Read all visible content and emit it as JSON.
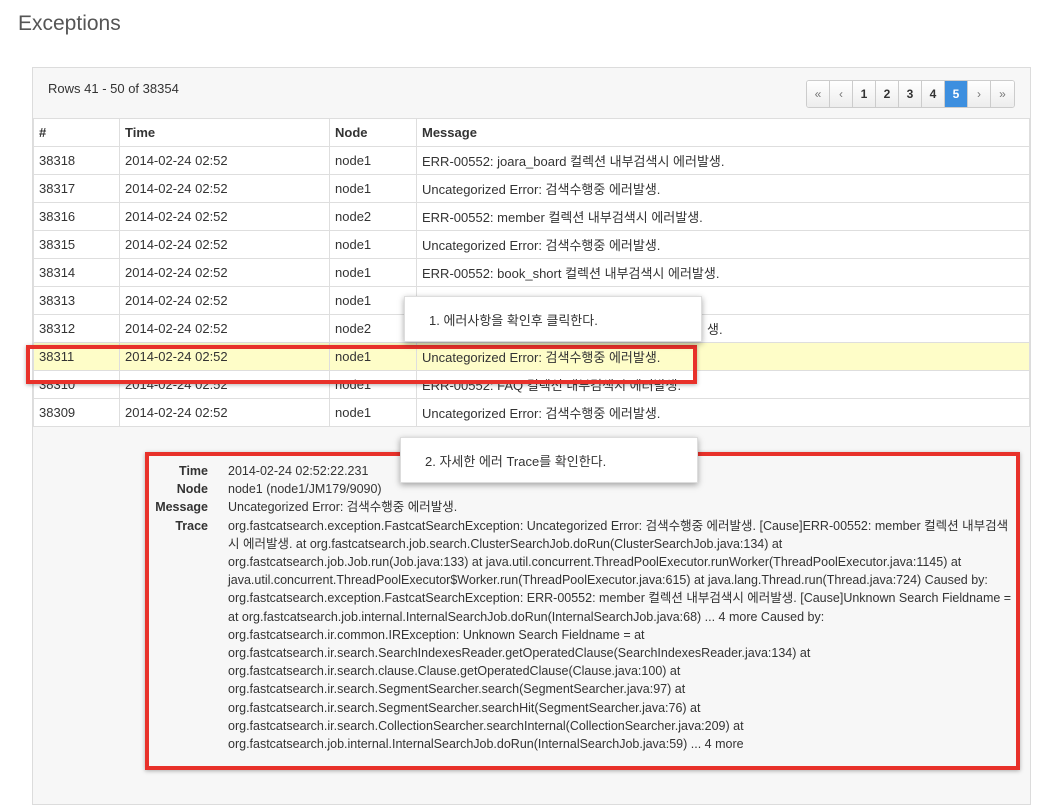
{
  "page": {
    "title": "Exceptions"
  },
  "summary": {
    "rows_text": "Rows 41 - 50 of 38354"
  },
  "pagination": {
    "first": "«",
    "prev": "‹",
    "next": "›",
    "last": "»",
    "pages": [
      "1",
      "2",
      "3",
      "4",
      "5"
    ],
    "active": "5"
  },
  "table": {
    "headers": [
      "#",
      "Time",
      "Node",
      "Message"
    ],
    "rows": [
      {
        "id": "38318",
        "time": "2014-02-24 02:52",
        "node": "node1",
        "message": "ERR-00552: joara_board 컬렉션 내부검색시 에러발생."
      },
      {
        "id": "38317",
        "time": "2014-02-24 02:52",
        "node": "node1",
        "message": "Uncategorized Error: 검색수행중 에러발생."
      },
      {
        "id": "38316",
        "time": "2014-02-24 02:52",
        "node": "node2",
        "message": "ERR-00552: member 컬렉션 내부검색시 에러발생."
      },
      {
        "id": "38315",
        "time": "2014-02-24 02:52",
        "node": "node1",
        "message": "Uncategorized Error: 검색수행중 에러발생."
      },
      {
        "id": "38314",
        "time": "2014-02-24 02:52",
        "node": "node1",
        "message": "ERR-00552: book_short 컬렉션 내부검색시 에러발생."
      },
      {
        "id": "38313",
        "time": "2014-02-24 02:52",
        "node": "node1",
        "message": ""
      },
      {
        "id": "38312",
        "time": "2014-02-24 02:52",
        "node": "node2",
        "message": "생."
      },
      {
        "id": "38311",
        "time": "2014-02-24 02:52",
        "node": "node1",
        "message": "Uncategorized Error: 검색수행중 에러발생."
      },
      {
        "id": "38310",
        "time": "2014-02-24 02:52",
        "node": "node1",
        "message": "ERR-00552: FAQ 컬렉션 내부검색시 에러발생."
      },
      {
        "id": "38309",
        "time": "2014-02-24 02:52",
        "node": "node1",
        "message": "Uncategorized Error: 검색수행중 에러발생."
      }
    ]
  },
  "detail": {
    "time_label": "Time",
    "time": "2014-02-24 02:52:22.231",
    "node_label": "Node",
    "node": "node1 (node1/JM179/9090)",
    "message_label": "Message",
    "message": "Uncategorized Error: 검색수행중 에러발생.",
    "trace_label": "Trace",
    "trace": "org.fastcatsearch.exception.FastcatSearchException: Uncategorized Error: 검색수행중 에러발생. [Cause]ERR-00552: member 컬렉션 내부검색시 에러발생. at org.fastcatsearch.job.search.ClusterSearchJob.doRun(ClusterSearchJob.java:134) at org.fastcatsearch.job.Job.run(Job.java:133) at java.util.concurrent.ThreadPoolExecutor.runWorker(ThreadPoolExecutor.java:1145) at java.util.concurrent.ThreadPoolExecutor$Worker.run(ThreadPoolExecutor.java:615) at java.lang.Thread.run(Thread.java:724) Caused by: org.fastcatsearch.exception.FastcatSearchException: ERR-00552: member 컬렉션 내부검색시 에러발생. [Cause]Unknown Search Fieldname = at org.fastcatsearch.job.internal.InternalSearchJob.doRun(InternalSearchJob.java:68) ... 4 more Caused by: org.fastcatsearch.ir.common.IRException: Unknown Search Fieldname = at org.fastcatsearch.ir.search.SearchIndexesReader.getOperatedClause(SearchIndexesReader.java:134) at org.fastcatsearch.ir.search.clause.Clause.getOperatedClause(Clause.java:100) at org.fastcatsearch.ir.search.SegmentSearcher.search(SegmentSearcher.java:97) at org.fastcatsearch.ir.search.SegmentSearcher.searchHit(SegmentSearcher.java:76) at org.fastcatsearch.ir.search.CollectionSearcher.searchInternal(CollectionSearcher.java:209) at org.fastcatsearch.job.internal.InternalSearchJob.doRun(InternalSearchJob.java:59) ... 4 more"
  },
  "callouts": {
    "step1": "1. 에러사항을 확인후 클릭한다.",
    "step2": "2. 자세한 에러 Trace를 확인한다."
  },
  "colors": {
    "highlight_row": "#fefdc8",
    "callout_border": "#e8312a",
    "pager_active": "#3d8fdf"
  }
}
